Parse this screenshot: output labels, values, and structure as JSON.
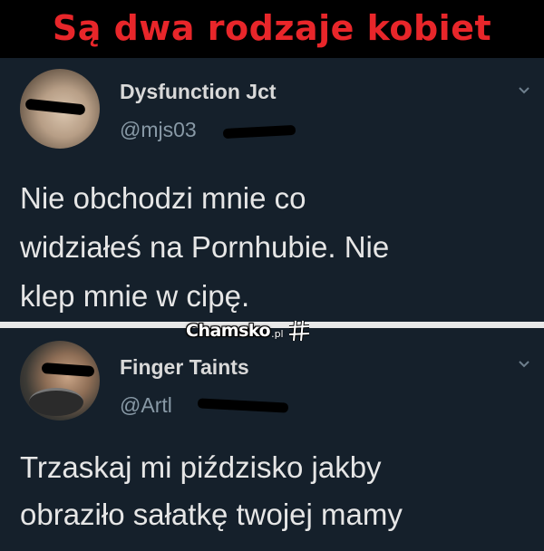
{
  "header": {
    "title": "Są dwa rodzaje kobiet",
    "title_color": "#e8262a"
  },
  "tweets": [
    {
      "name": "Dysfunction Jct",
      "handle": "@mjs03",
      "text_lines": [
        "Nie obchodzi mnie co",
        "widziałeś na Pornhubie. Nie",
        "klep mnie w cipę."
      ],
      "avatar_icon": "user-avatar",
      "menu_icon": "chevron-down-icon"
    },
    {
      "name": "Finger Taints",
      "handle": "@Artl",
      "text_lines": [
        "Trzaskaj mi piździsko jakby",
        "obraziło sałatkę twojej mamy"
      ],
      "avatar_icon": "user-avatar",
      "menu_icon": "chevron-down-icon"
    }
  ],
  "watermark": {
    "brand": "Chamsko",
    "suffix": ".pl",
    "icon": "hashtag-grid-icon"
  },
  "colors": {
    "tweet_background": "#15202b",
    "name_color": "#d9d9d9",
    "handle_color": "#8899a6",
    "body_text_color": "#e6e6e6",
    "divider_color": "#e8e8e8"
  }
}
